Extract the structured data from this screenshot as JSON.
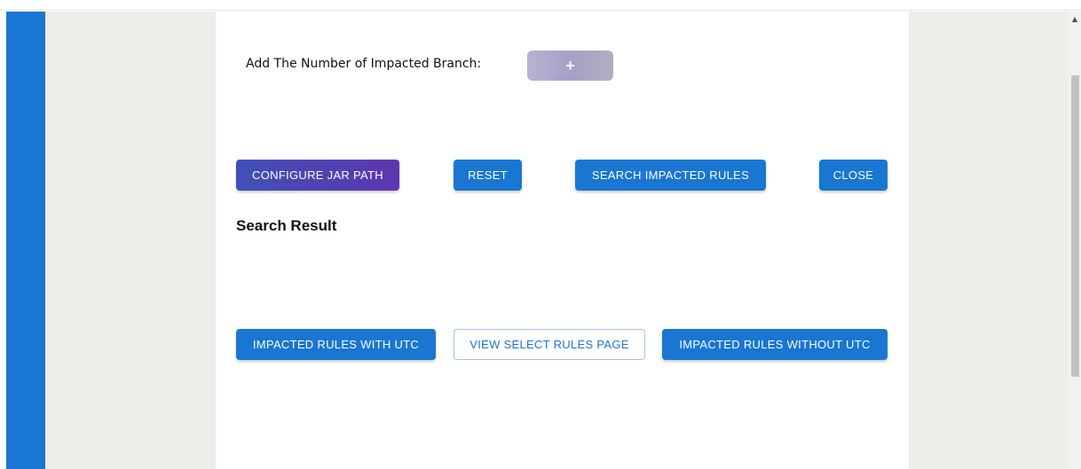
{
  "colors": {
    "primary": "#1976d2",
    "side_panel": "#eeede9",
    "gradient_start": "#3f51b5",
    "gradient_end": "#5e35b1",
    "add_button": "#b1aac8"
  },
  "scrollbar": {
    "up_arrow_icon": "▲"
  },
  "branch": {
    "label": "Add The Number of Impacted Branch:",
    "add_button_label": "+",
    "add_button_icon": "plus-icon"
  },
  "actions": {
    "configure_jar_path": "CONFIGURE JAR PATH",
    "reset": "RESET",
    "search_impacted_rules": "SEARCH IMPACTED RULES",
    "close": "CLOSE"
  },
  "search_result": {
    "title": "Search Result"
  },
  "results_actions": {
    "with_utc": "IMPACTED RULES WITH UTC",
    "view_select_rules": "VIEW SELECT RULES PAGE",
    "without_utc": "IMPACTED RULES WITHOUT UTC"
  }
}
